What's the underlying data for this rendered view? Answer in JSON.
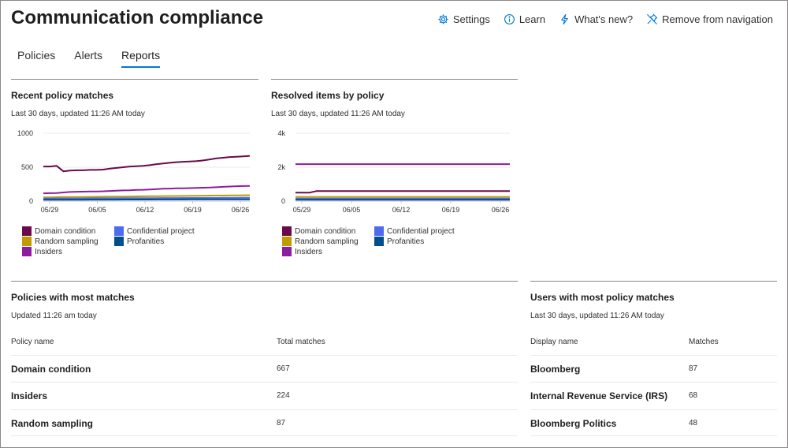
{
  "page_title": "Communication compliance",
  "top_actions": {
    "settings": "Settings",
    "learn": "Learn",
    "whats_new": "What's new?",
    "remove_nav": "Remove from navigation"
  },
  "tabs": [
    {
      "label": "Policies"
    },
    {
      "label": "Alerts"
    },
    {
      "label": "Reports"
    }
  ],
  "recent_card": {
    "title": "Recent policy matches",
    "subtitle": "Last 30 days, updated 11:26 AM today"
  },
  "resolved_card": {
    "title": "Resolved items by policy",
    "subtitle": "Last 30 days, updated 11:26 AM today"
  },
  "legend": [
    {
      "label": "Domain condition",
      "color": "#6b0a4a"
    },
    {
      "label": "Confidential project",
      "color": "#4f6bed"
    },
    {
      "label": "Random sampling",
      "color": "#c19c00"
    },
    {
      "label": "Profanities",
      "color": "#004e8c"
    },
    {
      "label": "Insiders",
      "color": "#8e1c9e"
    }
  ],
  "chart_data": [
    {
      "type": "line",
      "title": "Recent policy matches",
      "x_ticks": [
        "05/29",
        "06/05",
        "06/12",
        "06/19",
        "06/26"
      ],
      "ylim": [
        0,
        1000
      ],
      "y_ticks": [
        "1000",
        "500",
        "0"
      ],
      "y_tick_values": [
        1000,
        500,
        0
      ],
      "series": [
        {
          "name": "Domain condition",
          "color": "#6b0a4a",
          "values": [
            510,
            510,
            520,
            440,
            450,
            455,
            455,
            460,
            460,
            465,
            480,
            490,
            500,
            510,
            515,
            520,
            530,
            545,
            555,
            565,
            575,
            580,
            585,
            590,
            600,
            615,
            630,
            640,
            650,
            655,
            660,
            667
          ]
        },
        {
          "name": "Insiders",
          "color": "#8e1c9e",
          "values": [
            115,
            118,
            120,
            128,
            135,
            138,
            140,
            142,
            143,
            145,
            150,
            155,
            158,
            160,
            165,
            168,
            172,
            178,
            182,
            185,
            188,
            190,
            192,
            195,
            198,
            200,
            205,
            210,
            215,
            220,
            222,
            224
          ]
        },
        {
          "name": "Random sampling",
          "color": "#c19c00",
          "values": [
            55,
            56,
            58,
            60,
            60,
            61,
            62,
            63,
            64,
            65,
            66,
            67,
            68,
            69,
            70,
            71,
            72,
            73,
            74,
            75,
            76,
            77,
            78,
            79,
            80,
            81,
            82,
            83,
            84,
            85,
            86,
            87
          ]
        },
        {
          "name": "Confidential project",
          "color": "#4f6bed",
          "values": [
            38,
            38,
            39,
            39,
            40,
            40,
            40,
            41,
            41,
            42,
            42,
            42,
            43,
            43,
            43,
            44,
            44,
            44,
            45,
            45,
            45,
            46,
            46,
            46,
            47,
            47,
            47,
            48,
            48,
            48,
            49,
            49
          ]
        },
        {
          "name": "Profanities",
          "color": "#004e8c",
          "values": [
            20,
            20,
            20,
            21,
            21,
            21,
            21,
            22,
            22,
            22,
            22,
            22,
            23,
            23,
            23,
            23,
            23,
            24,
            24,
            24,
            24,
            24,
            25,
            25,
            25,
            25,
            25,
            26,
            26,
            26,
            26,
            26
          ]
        }
      ]
    },
    {
      "type": "line",
      "title": "Resolved items by policy",
      "x_ticks": [
        "05/29",
        "06/05",
        "06/12",
        "06/19",
        "06/26"
      ],
      "ylim": [
        0,
        4000
      ],
      "y_ticks": [
        "4k",
        "2k",
        "0"
      ],
      "y_tick_values": [
        4000,
        2000,
        0
      ],
      "series": [
        {
          "name": "Insiders",
          "color": "#8e1c9e",
          "values": [
            2180,
            2180,
            2180,
            2180,
            2180,
            2180,
            2180,
            2180,
            2180,
            2180,
            2180,
            2180,
            2180,
            2180,
            2180,
            2180,
            2180,
            2180,
            2180,
            2180,
            2180,
            2180,
            2180,
            2180,
            2180,
            2180,
            2180,
            2180,
            2180,
            2180,
            2180,
            2180
          ]
        },
        {
          "name": "Domain condition",
          "color": "#6b0a4a",
          "values": [
            500,
            500,
            500,
            590,
            590,
            590,
            590,
            590,
            590,
            590,
            590,
            590,
            590,
            590,
            590,
            590,
            590,
            590,
            590,
            590,
            590,
            590,
            590,
            590,
            590,
            590,
            590,
            590,
            590,
            590,
            590,
            590
          ]
        },
        {
          "name": "Random sampling",
          "color": "#c19c00",
          "values": [
            250,
            250,
            250,
            250,
            250,
            250,
            250,
            250,
            250,
            250,
            250,
            250,
            250,
            250,
            250,
            250,
            250,
            250,
            250,
            250,
            250,
            250,
            250,
            250,
            250,
            250,
            250,
            250,
            250,
            250,
            250,
            250
          ]
        },
        {
          "name": "Confidential project",
          "color": "#4f6bed",
          "values": [
            150,
            150,
            150,
            150,
            150,
            150,
            150,
            150,
            150,
            150,
            150,
            150,
            150,
            150,
            150,
            150,
            150,
            150,
            150,
            150,
            150,
            150,
            150,
            150,
            150,
            150,
            150,
            150,
            150,
            150,
            150,
            150
          ]
        },
        {
          "name": "Profanities",
          "color": "#004e8c",
          "values": [
            80,
            80,
            80,
            80,
            80,
            80,
            80,
            80,
            80,
            80,
            80,
            80,
            80,
            80,
            80,
            80,
            80,
            80,
            80,
            80,
            80,
            80,
            80,
            80,
            80,
            80,
            80,
            80,
            80,
            80,
            80,
            80
          ]
        }
      ]
    },
    {
      "type": "table",
      "title": "Policies with most matches",
      "subtitle": "Updated 11:26 am today",
      "columns": [
        "Policy name",
        "Total matches"
      ],
      "rows": [
        [
          "Domain condition",
          "667"
        ],
        [
          "Insiders",
          "224"
        ],
        [
          "Random sampling",
          "87"
        ]
      ]
    },
    {
      "type": "table",
      "title": "Users with most policy matches",
      "subtitle": "Last 30 days, updated 11:26 AM today",
      "columns": [
        "Display name",
        "Matches"
      ],
      "rows": [
        [
          "Bloomberg",
          "87"
        ],
        [
          "Internal Revenue Service (IRS)",
          "68"
        ],
        [
          "Bloomberg Politics",
          "48"
        ]
      ]
    }
  ]
}
